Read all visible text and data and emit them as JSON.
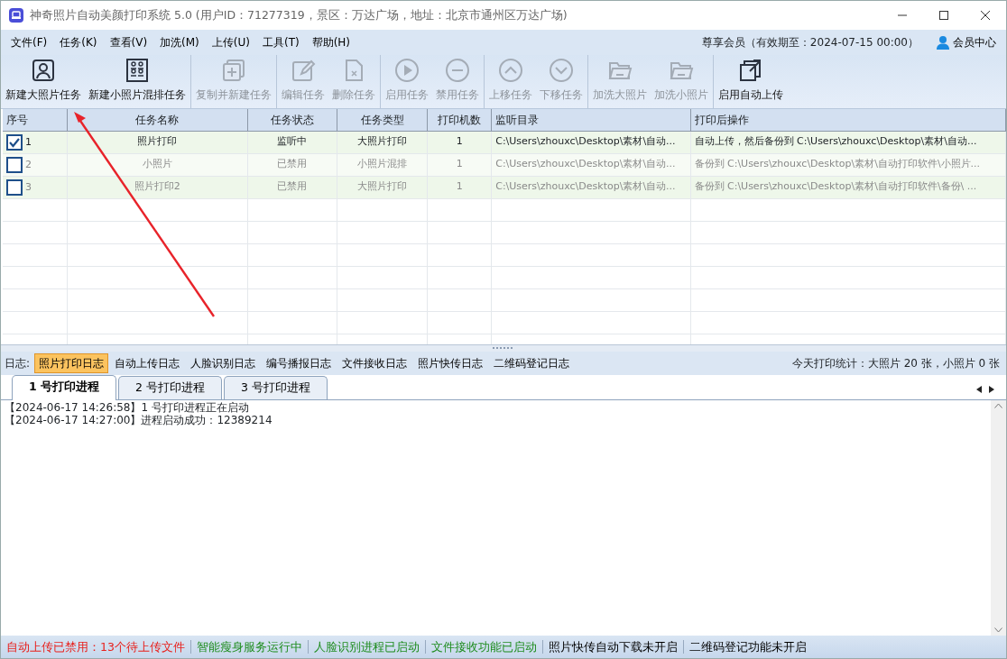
{
  "window": {
    "title": "神奇照片自动美颜打印系统 5.0 (用户ID：71277319，景区：万达广场，地址：北京市通州区万达广场)"
  },
  "menu": [
    "文件(F)",
    "任务(K)",
    "查看(V)",
    "加洗(M)",
    "上传(U)",
    "工具(T)",
    "帮助(H)"
  ],
  "membership": "尊享会员（有效期至：2024-07-15 00:00）",
  "member_center": "会员中心",
  "toolbar_groups": [
    {
      "buttons": [
        {
          "label": "新建大照片任务",
          "kind": "portrait",
          "disabled": false
        },
        {
          "label": "新建小照片混排任务",
          "kind": "grid",
          "disabled": false
        }
      ]
    },
    {
      "buttons": [
        {
          "label": "复制并新建任务",
          "kind": "copy",
          "disabled": true
        }
      ]
    },
    {
      "buttons": [
        {
          "label": "编辑任务",
          "kind": "edit",
          "disabled": true
        },
        {
          "label": "删除任务",
          "kind": "delete",
          "disabled": true
        }
      ]
    },
    {
      "buttons": [
        {
          "label": "启用任务",
          "kind": "play",
          "disabled": true
        },
        {
          "label": "禁用任务",
          "kind": "minus",
          "disabled": true
        }
      ]
    },
    {
      "buttons": [
        {
          "label": "上移任务",
          "kind": "up",
          "disabled": true
        },
        {
          "label": "下移任务",
          "kind": "down",
          "disabled": true
        }
      ]
    },
    {
      "buttons": [
        {
          "label": "加洗大照片",
          "kind": "folder",
          "disabled": true
        },
        {
          "label": "加洗小照片",
          "kind": "folder",
          "disabled": true
        }
      ]
    },
    {
      "buttons": [
        {
          "label": "启用自动上传",
          "kind": "upload",
          "disabled": false
        }
      ]
    }
  ],
  "table": {
    "columns": [
      "序号",
      "任务名称",
      "任务状态",
      "任务类型",
      "打印机数",
      "监听目录",
      "打印后操作"
    ],
    "rows": [
      {
        "checked": true,
        "disabled": false,
        "cells": [
          "1",
          "照片打印",
          "监听中",
          "大照片打印",
          "1",
          "C:\\Users\\zhouxc\\Desktop\\素材\\自动...",
          "自动上传，然后备份到 C:\\Users\\zhouxc\\Desktop\\素材\\自动..."
        ]
      },
      {
        "checked": false,
        "disabled": true,
        "cells": [
          "2",
          "小照片",
          "已禁用",
          "小照片混排",
          "1",
          "C:\\Users\\zhouxc\\Desktop\\素材\\自动...",
          "备份到 C:\\Users\\zhouxc\\Desktop\\素材\\自动打印软件\\小照片..."
        ]
      },
      {
        "checked": false,
        "disabled": true,
        "cells": [
          "3",
          "照片打印2",
          "已禁用",
          "大照片打印",
          "1",
          "C:\\Users\\zhouxc\\Desktop\\素材\\自动...",
          "备份到 C:\\Users\\zhouxc\\Desktop\\素材\\自动打印软件\\备份\\ ..."
        ]
      }
    ]
  },
  "log_bar": {
    "label": "日志:",
    "tabs": [
      {
        "label": "照片打印日志",
        "selected": true
      },
      {
        "label": "自动上传日志",
        "selected": false
      },
      {
        "label": "人脸识别日志",
        "selected": false
      },
      {
        "label": "编号播报日志",
        "selected": false
      },
      {
        "label": "文件接收日志",
        "selected": false
      },
      {
        "label": "照片快传日志",
        "selected": false
      },
      {
        "label": "二维码登记日志",
        "selected": false
      }
    ],
    "stats": "今天打印统计：大照片 20 张，小照片 0 张"
  },
  "process_tabs": [
    {
      "label": "1 号打印进程",
      "selected": true
    },
    {
      "label": "2 号打印进程",
      "selected": false
    },
    {
      "label": "3 号打印进程",
      "selected": false
    }
  ],
  "log_lines": [
    "【2024-06-17 14:26:58】1 号打印进程正在启动",
    "【2024-06-17 14:27:00】进程启动成功：12389214"
  ],
  "status_bar": [
    {
      "text": "自动上传已禁用：13个待上传文件",
      "color": "#e8201c"
    },
    {
      "text": "智能瘦身服务运行中",
      "color": "#1e8c1e"
    },
    {
      "text": "人脸识别进程已启动",
      "color": "#1e8c1e"
    },
    {
      "text": "文件接收功能已启动",
      "color": "#1e8c1e"
    },
    {
      "text": "照片快传自动下载未开启",
      "color": "#000000"
    },
    {
      "text": "二维码登记功能未开启",
      "color": "#000000"
    }
  ]
}
